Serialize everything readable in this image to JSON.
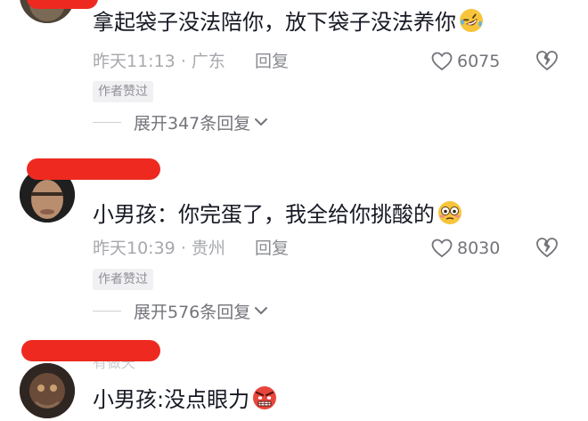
{
  "comments": [
    {
      "text": "拿起袋子没法陪你，放下袋子没法养你",
      "emoji": "rofl-emoji",
      "time": "昨天11:13",
      "separator": "·",
      "location": "广东",
      "reply_label": "回复",
      "likes": "6075",
      "badge": "作者赞过",
      "expand_label": "展开347条回复"
    },
    {
      "text": "小男孩：你完蛋了，我全给你挑酸的",
      "emoji": "flushed-emoji",
      "time": "昨天10:39",
      "separator": "·",
      "location": "贵州",
      "reply_label": "回复",
      "likes": "8030",
      "badge": "作者赞过",
      "expand_label": "展开576条回复"
    },
    {
      "username": "有做天",
      "text": "小男孩:没点眼力",
      "emoji": "angry-emoji"
    }
  ],
  "colors": {
    "redaction": "#ee2a20",
    "text": "#161823",
    "meta": "#a7a8ad",
    "badge_bg": "#f1f1f3"
  }
}
